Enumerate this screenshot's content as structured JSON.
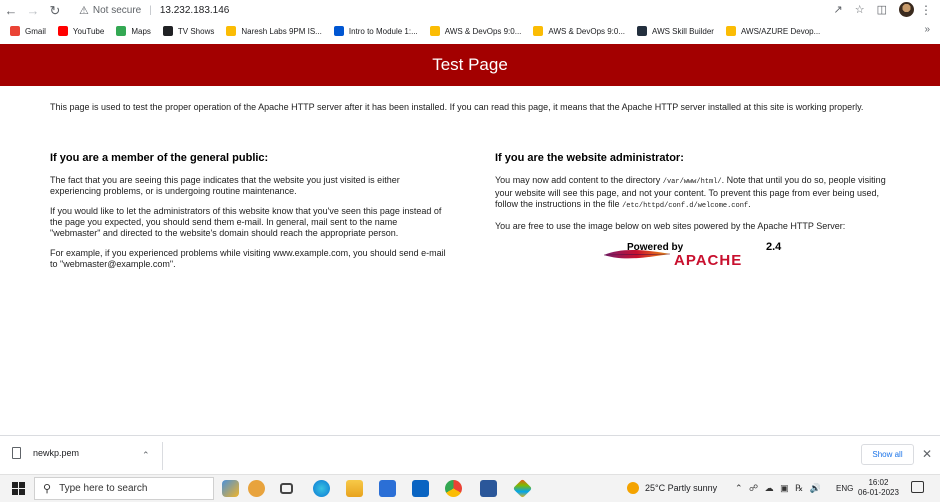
{
  "browser": {
    "security_label": "Not secure",
    "url": "13.232.183.146",
    "bookmarks": [
      {
        "label": "Gmail",
        "icon": "gmail-icon",
        "color": "#ea4335"
      },
      {
        "label": "YouTube",
        "icon": "youtube-icon",
        "color": "#ff0000"
      },
      {
        "label": "Maps",
        "icon": "maps-icon",
        "color": "#34a853"
      },
      {
        "label": "TV Shows",
        "icon": "tv-icon",
        "color": "#202124"
      },
      {
        "label": "Naresh Labs 9PM IS...",
        "icon": "drive-icon",
        "color": "#fbbc04"
      },
      {
        "label": "Intro to Module 1:...",
        "icon": "coursera-icon",
        "color": "#0056d2"
      },
      {
        "label": "AWS & DevOps 9:0...",
        "icon": "drive-icon",
        "color": "#fbbc04"
      },
      {
        "label": "AWS & DevOps 9:0...",
        "icon": "drive-icon",
        "color": "#fbbc04"
      },
      {
        "label": "AWS Skill Builder",
        "icon": "aws-icon",
        "color": "#232f3e"
      },
      {
        "label": "AWS/AZURE Devop...",
        "icon": "drive-icon",
        "color": "#fbbc04"
      }
    ]
  },
  "page": {
    "title": "Test Page",
    "banner_color": "#a30000",
    "intro": "This page is used to test the proper operation of the Apache HTTP server after it has been installed. If you can read this page, it means that the Apache HTTP server installed at this site is working properly.",
    "public": {
      "heading": "If you are a member of the general public:",
      "p1": "The fact that you are seeing this page indicates that the website you just visited is either experiencing problems, or is undergoing routine maintenance.",
      "p2": "If you would like to let the administrators of this website know that you've seen this page instead of the page you expected, you should send them e-mail. In general, mail sent to the name \"webmaster\" and directed to the website's domain should reach the appropriate person.",
      "p3": "For example, if you experienced problems while visiting www.example.com, you should send e-mail to \"webmaster@example.com\"."
    },
    "admin": {
      "heading": "If you are the website administrator:",
      "p1_a": "You may now add content to the directory ",
      "p1_code": "/var/www/html/",
      "p1_b": ". Note that until you do so, people visiting your website will see this page, and not your content. To prevent this page from ever being used, follow the instructions in the file ",
      "p1_code2": "/etc/httpd/conf.d/welcome.conf",
      "p1_c": ".",
      "p2": "You are free to use the image below on web sites powered by the Apache HTTP Server:",
      "logo_powered": "Powered by",
      "logo_word": "APACHE",
      "logo_version": "2.4"
    }
  },
  "downloads": {
    "file_name": "newkp.pem",
    "show_all": "Show all"
  },
  "taskbar": {
    "search_placeholder": "Type here to search",
    "weather": "25°C  Partly sunny",
    "language": "ENG",
    "time": "16:02",
    "date": "06-01-2023"
  }
}
